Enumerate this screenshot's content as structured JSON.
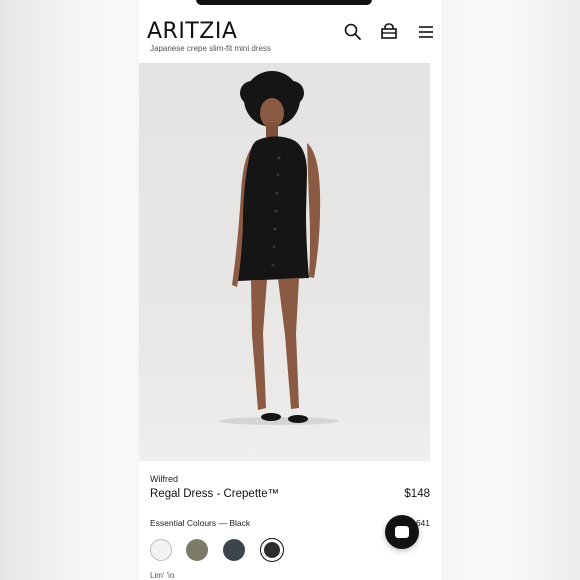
{
  "header": {
    "logo": "ARITZIA",
    "subtitle": "Japanese crepe slim-fit mini dress",
    "icons": [
      "search-icon",
      "bag-icon",
      "menu-icon"
    ]
  },
  "product": {
    "brand": "Wilfred",
    "name": "Regal Dress - Crepette™",
    "price": "$148",
    "colour_label": "Essential Colours — Black",
    "colour_code": "641",
    "bottom_text": "Lim'  'io",
    "swatches": [
      {
        "name": "white",
        "color": "#f3f2f0",
        "selected": false
      },
      {
        "name": "olive",
        "color": "#7c7a68",
        "selected": false
      },
      {
        "name": "charcoal",
        "color": "#3e444c",
        "selected": false
      },
      {
        "name": "black",
        "color": "#2b2b2b",
        "selected": true
      }
    ]
  },
  "colors": {
    "accent": "#111111",
    "background": "#ffffff"
  }
}
